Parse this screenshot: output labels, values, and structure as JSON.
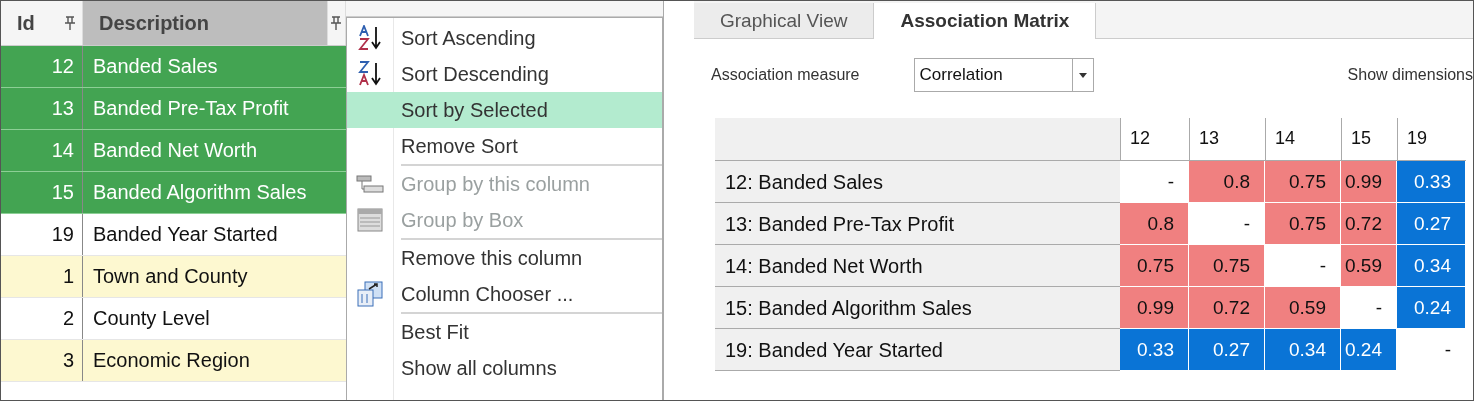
{
  "grid": {
    "columns": [
      {
        "label": "Id",
        "pinned": true
      },
      {
        "label": "Description",
        "pinned": true
      }
    ],
    "rows": [
      {
        "id": "12",
        "description": "Banded Sales",
        "selected": true
      },
      {
        "id": "13",
        "description": "Banded Pre-Tax Profit",
        "selected": true
      },
      {
        "id": "14",
        "description": "Banded Net Worth",
        "selected": true
      },
      {
        "id": "15",
        "description": "Banded Algorithm Sales",
        "selected": true
      },
      {
        "id": "19",
        "description": "Banded Year Started",
        "selected": false
      },
      {
        "id": "1",
        "description": "Town and County",
        "selected": false
      },
      {
        "id": "2",
        "description": "County Level",
        "selected": false
      },
      {
        "id": "3",
        "description": "Economic Region",
        "selected": false
      }
    ]
  },
  "context_menu": {
    "items": [
      {
        "label": "Sort Ascending",
        "kind": "sort-ascending",
        "selected": false,
        "disabled": false,
        "separator_before": false
      },
      {
        "label": "Sort Descending",
        "kind": "sort-descending",
        "selected": false,
        "disabled": false,
        "separator_before": false
      },
      {
        "label": "Sort by Selected",
        "kind": "plain",
        "selected": true,
        "disabled": false,
        "separator_before": false
      },
      {
        "label": "Remove Sort",
        "kind": "plain",
        "selected": false,
        "disabled": false,
        "separator_before": false
      },
      {
        "label": "Group by this column",
        "kind": "group-column",
        "selected": false,
        "disabled": true,
        "separator_before": true
      },
      {
        "label": "Group by Box",
        "kind": "group-box",
        "selected": false,
        "disabled": true,
        "separator_before": false
      },
      {
        "label": "Remove this column",
        "kind": "plain",
        "selected": false,
        "disabled": false,
        "separator_before": true
      },
      {
        "label": "Column Chooser ...",
        "kind": "column-chooser",
        "selected": false,
        "disabled": false,
        "separator_before": false
      },
      {
        "label": "Best Fit",
        "kind": "plain",
        "selected": false,
        "disabled": false,
        "separator_before": true
      },
      {
        "label": "Show all columns",
        "kind": "plain",
        "selected": false,
        "disabled": false,
        "separator_before": false
      }
    ]
  },
  "tabs": [
    {
      "label": "Graphical View",
      "selected": false
    },
    {
      "label": "Association Matrix",
      "selected": true
    }
  ],
  "association_measure": {
    "label": "Association measure",
    "value": "Correlation"
  },
  "show_dimensions": {
    "label": "Show dimensions"
  },
  "matrix": {
    "columns": [
      "12",
      "13",
      "14",
      "15",
      "19"
    ],
    "rows": [
      {
        "label": "12: Banded Sales",
        "cells": [
          {
            "text": "-"
          },
          {
            "text": "0.8",
            "color": "#f08080"
          },
          {
            "text": "0.75",
            "color": "#f08080"
          },
          {
            "text": "0.99",
            "color": "#f08080"
          },
          {
            "text": "0.33",
            "color": "#0a74d6"
          }
        ]
      },
      {
        "label": "13: Banded Pre-Tax Profit",
        "cells": [
          {
            "text": "0.8",
            "color": "#f08080"
          },
          {
            "text": "-"
          },
          {
            "text": "0.75",
            "color": "#f08080"
          },
          {
            "text": "0.72",
            "color": "#f08080"
          },
          {
            "text": "0.27",
            "color": "#0a74d6"
          }
        ]
      },
      {
        "label": "14: Banded Net Worth",
        "cells": [
          {
            "text": "0.75",
            "color": "#f08080"
          },
          {
            "text": "0.75",
            "color": "#f08080"
          },
          {
            "text": "-"
          },
          {
            "text": "0.59",
            "color": "#f08080"
          },
          {
            "text": "0.34",
            "color": "#0a74d6"
          }
        ]
      },
      {
        "label": "15: Banded Algorithm Sales",
        "cells": [
          {
            "text": "0.99",
            "color": "#f08080"
          },
          {
            "text": "0.72",
            "color": "#f08080"
          },
          {
            "text": "0.59",
            "color": "#f08080"
          },
          {
            "text": "-"
          },
          {
            "text": "0.24",
            "color": "#0a74d6"
          }
        ]
      },
      {
        "label": "19: Banded Year Started",
        "cells": [
          {
            "text": "0.33",
            "color": "#0a74d6"
          },
          {
            "text": "0.27",
            "color": "#0a74d6"
          },
          {
            "text": "0.34",
            "color": "#0a74d6"
          },
          {
            "text": "0.24",
            "color": "#0a74d6"
          },
          {
            "text": "-"
          }
        ]
      }
    ]
  }
}
